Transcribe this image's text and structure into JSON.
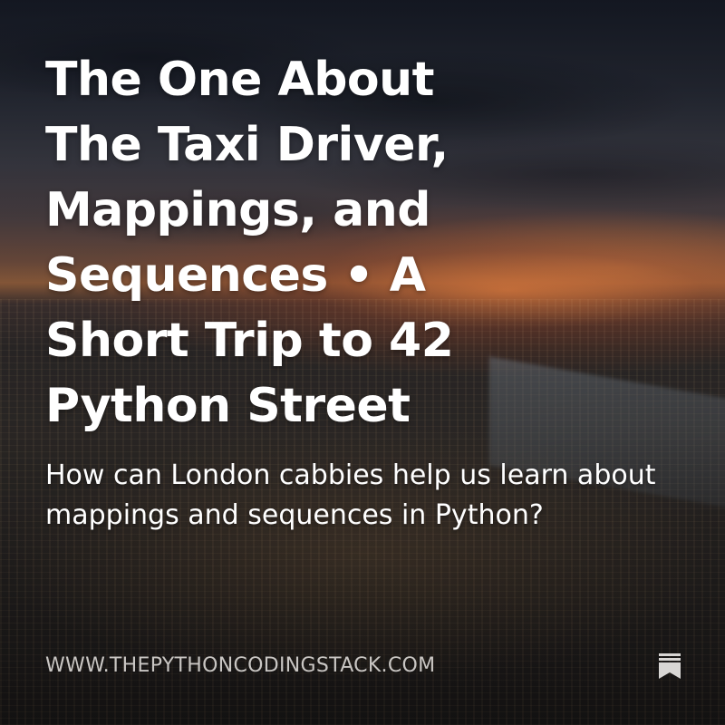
{
  "post": {
    "title": "The One About The Taxi Driver, Mappings, and Sequences • A Short Trip to 42 Python Street",
    "subtitle": "How can London cabbies help us learn about mappings and sequences in Python?",
    "site_url": "WWW.THEPYTHONCODINGSTACK.COM",
    "icon": "bookmark-icon"
  }
}
